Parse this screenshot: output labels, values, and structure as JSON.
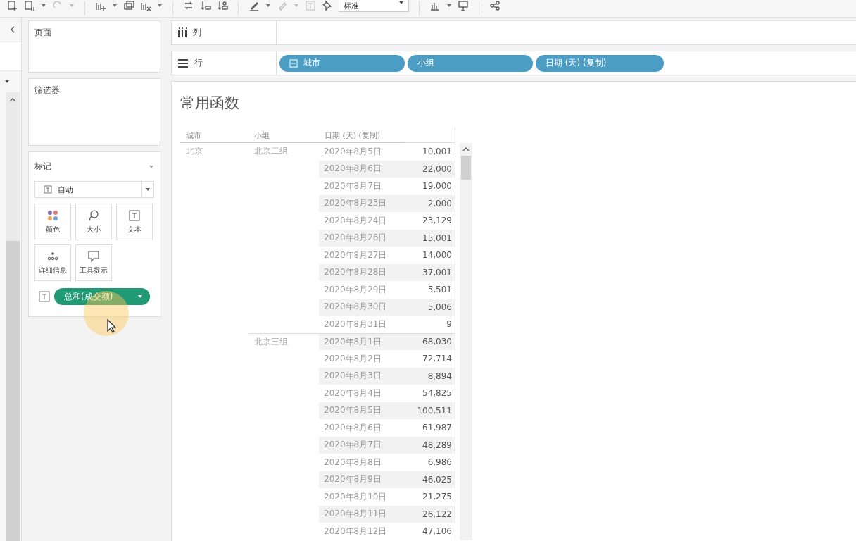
{
  "toolbar": {
    "fit_dropdown": "标准"
  },
  "pages_shelf": {
    "title": "页面"
  },
  "filters_shelf": {
    "title": "筛选器"
  },
  "marks": {
    "title": "标记",
    "mark_type": "自动",
    "cards": [
      {
        "label": "颜色",
        "kind": "color"
      },
      {
        "label": "大小",
        "kind": "size"
      },
      {
        "label": "文本",
        "kind": "text"
      },
      {
        "label": "详细信息",
        "kind": "detail"
      },
      {
        "label": "工具提示",
        "kind": "tooltip"
      }
    ],
    "pill": {
      "label": "总和(成交额)"
    }
  },
  "columns_shelf": {
    "label": "列"
  },
  "rows_shelf": {
    "label": "行",
    "pills": [
      {
        "label": "城市",
        "collapsible": true
      },
      {
        "label": "小组",
        "collapsible": false
      },
      {
        "label": "日期 (天) (复制)",
        "collapsible": false
      }
    ]
  },
  "view": {
    "title": "常用函数",
    "headers": [
      "城市",
      "小组",
      "日期 (天) (复制)"
    ],
    "cities": [
      {
        "name": "北京",
        "groups": [
          {
            "name": "北京二组",
            "rows": [
              {
                "date": "2020年8月5日",
                "value": "10,001"
              },
              {
                "date": "2020年8月6日",
                "value": "22,000"
              },
              {
                "date": "2020年8月7日",
                "value": "19,000"
              },
              {
                "date": "2020年8月23日",
                "value": "2,000"
              },
              {
                "date": "2020年8月24日",
                "value": "23,129"
              },
              {
                "date": "2020年8月26日",
                "value": "15,001"
              },
              {
                "date": "2020年8月27日",
                "value": "14,000"
              },
              {
                "date": "2020年8月28日",
                "value": "37,001"
              },
              {
                "date": "2020年8月29日",
                "value": "5,501"
              },
              {
                "date": "2020年8月30日",
                "value": "5,006"
              },
              {
                "date": "2020年8月31日",
                "value": "9"
              }
            ]
          },
          {
            "name": "北京三组",
            "rows": [
              {
                "date": "2020年8月1日",
                "value": "68,030"
              },
              {
                "date": "2020年8月2日",
                "value": "72,714"
              },
              {
                "date": "2020年8月3日",
                "value": "8,894"
              },
              {
                "date": "2020年8月4日",
                "value": "54,825"
              },
              {
                "date": "2020年8月5日",
                "value": "100,511"
              },
              {
                "date": "2020年8月6日",
                "value": "61,987"
              },
              {
                "date": "2020年8月7日",
                "value": "48,289"
              },
              {
                "date": "2020年8月8日",
                "value": "6,986"
              },
              {
                "date": "2020年8月9日",
                "value": "46,025"
              },
              {
                "date": "2020年8月10日",
                "value": "21,275"
              },
              {
                "date": "2020年8月11日",
                "value": "26,122"
              },
              {
                "date": "2020年8月12日",
                "value": "47,106"
              }
            ]
          }
        ]
      }
    ]
  }
}
